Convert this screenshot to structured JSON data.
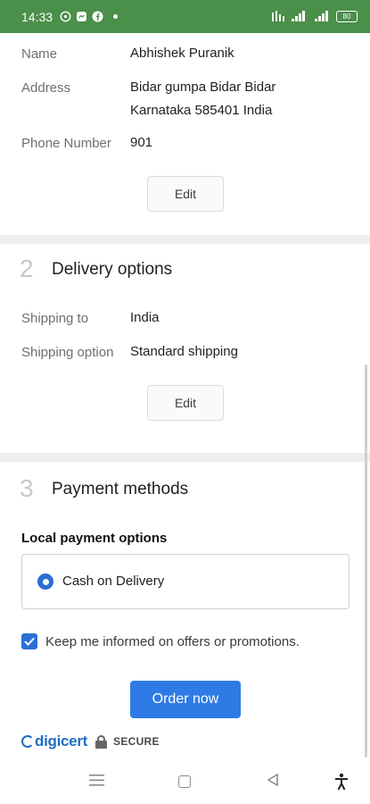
{
  "status_bar": {
    "time": "14:33",
    "app_icons": [
      "whatsapp-icon",
      "messenger-icon",
      "facebook-icon"
    ],
    "battery": "80"
  },
  "contact": {
    "name_label": "Name",
    "name_value": "Abhishek Puranik",
    "address_label": "Address",
    "address_line1": "Bidar gumpa Bidar Bidar",
    "address_line2": "Karnataka 585401 India",
    "phone_label": "Phone Number",
    "phone_value": "901",
    "edit_label": "Edit"
  },
  "delivery": {
    "number": "2",
    "title": "Delivery options",
    "shipping_to_label": "Shipping to",
    "shipping_to_value": "India",
    "shipping_option_label": "Shipping option",
    "shipping_option_value": "Standard shipping",
    "edit_label": "Edit"
  },
  "payment": {
    "number": "3",
    "title": "Payment methods",
    "local_title": "Local payment options",
    "option_label": "Cash on Delivery",
    "checkbox_label": "Keep me informed on offers or promotions.",
    "order_button": "Order now"
  },
  "footer": {
    "brand": "digicert",
    "secure": "SECURE"
  },
  "colors": {
    "status_bar": "#4a8f4a",
    "accent": "#2f7be5",
    "brand": "#1e6fc2"
  }
}
